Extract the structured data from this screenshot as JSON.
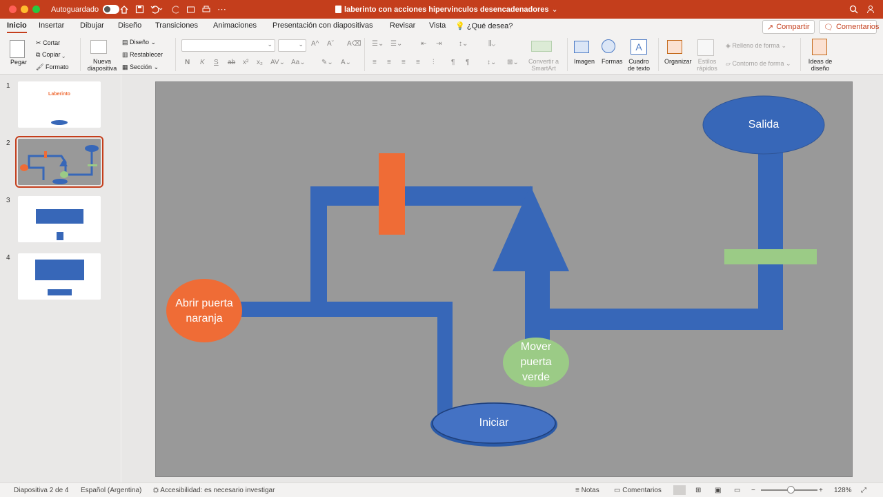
{
  "titlebar": {
    "autosave_label": "Autoguardado",
    "autosave_state": "off",
    "doc_title": "laberinto con acciones hipervinculos desencadenadores",
    "colors": {
      "accent": "#c43e1c"
    }
  },
  "tabs": [
    "Inicio",
    "Insertar",
    "Dibujar",
    "Diseño",
    "Transiciones",
    "Animaciones",
    "Presentación con diapositivas",
    "Revisar",
    "Vista"
  ],
  "tell_me": "¿Qué desea?",
  "share_label": "Compartir",
  "comments_label": "Comentarios",
  "ribbon": {
    "paste": "Pegar",
    "cut": "Cortar",
    "copy": "Copiar",
    "format": "Formato",
    "new_slide": "Nueva diapositiva",
    "layout": "Diseño",
    "reset": "Restablecer",
    "section": "Sección",
    "convert_smartart": "Convertir a SmartArt",
    "image": "Imagen",
    "shapes": "Formas",
    "textbox": "Cuadro de texto",
    "arrange": "Organizar",
    "quick_styles": "Estilos rápidos",
    "shape_fill": "Relleno de forma",
    "shape_outline": "Contorno de forma",
    "design_ideas": "Ideas de diseño"
  },
  "thumbnails": [
    {
      "num": "1",
      "title": "Laberinto"
    },
    {
      "num": "2"
    },
    {
      "num": "3"
    },
    {
      "num": "4"
    }
  ],
  "slide": {
    "background": "#999999",
    "path_color": "#3767b8",
    "orange": "#ef6c36",
    "green": "#9bcb86",
    "labels": {
      "exit": "Salida",
      "open_door": "Abrir puerta naranja",
      "move_door": "Mover puerta verde",
      "start": "Iniciar"
    }
  },
  "status": {
    "slide_info": "Diapositiva 2 de 4",
    "language": "Español (Argentina)",
    "accessibility": "Accesibilidad: es necesario investigar",
    "notes": "Notas",
    "comments": "Comentarios",
    "zoom": "128%"
  }
}
